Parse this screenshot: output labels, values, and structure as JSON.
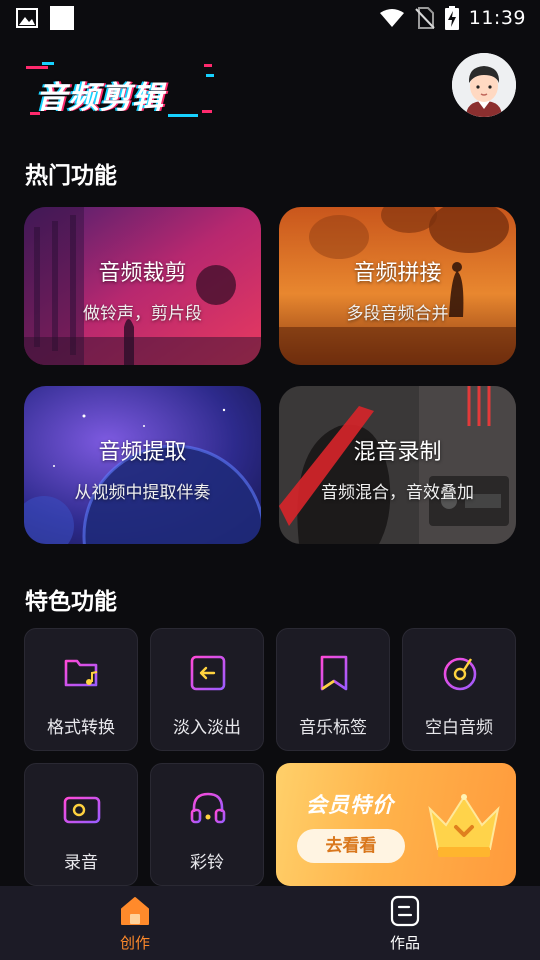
{
  "status_bar": {
    "time": "11:39"
  },
  "header": {
    "logo_text": "音频剪辑"
  },
  "hot_section": {
    "title": "热门功能",
    "cards": [
      {
        "title": "音频裁剪",
        "subtitle": "做铃声，剪片段"
      },
      {
        "title": "音频拼接",
        "subtitle": "多段音频合并"
      },
      {
        "title": "音频提取",
        "subtitle": "从视频中提取伴奏"
      },
      {
        "title": "混音录制",
        "subtitle": "音频混合，音效叠加"
      }
    ]
  },
  "feature_section": {
    "title": "特色功能",
    "items": [
      {
        "label": "格式转换",
        "icon": "folder-music-icon"
      },
      {
        "label": "淡入淡出",
        "icon": "fade-arrow-icon"
      },
      {
        "label": "音乐标签",
        "icon": "bookmark-tag-icon"
      },
      {
        "label": "空白音频",
        "icon": "vinyl-disc-icon"
      },
      {
        "label": "录音",
        "icon": "radio-recorder-icon"
      },
      {
        "label": "彩铃",
        "icon": "headphones-icon"
      }
    ]
  },
  "vip_banner": {
    "title": "会员特价",
    "button": "去看看",
    "icon": "crown-icon"
  },
  "bottom_nav": {
    "items": [
      {
        "label": "创作",
        "icon": "home-icon",
        "active": true
      },
      {
        "label": "作品",
        "icon": "works-icon",
        "active": false
      }
    ]
  },
  "colors": {
    "background": "#0c0c0f",
    "tile_background": "#1c1b24",
    "icon_gradient_start": "#ff4ad8",
    "icon_gradient_end": "#9b5cff",
    "icon_accent": "#ffd23f",
    "nav_active": "#ff8a2b",
    "vip_gradient": "#ffb24a"
  }
}
